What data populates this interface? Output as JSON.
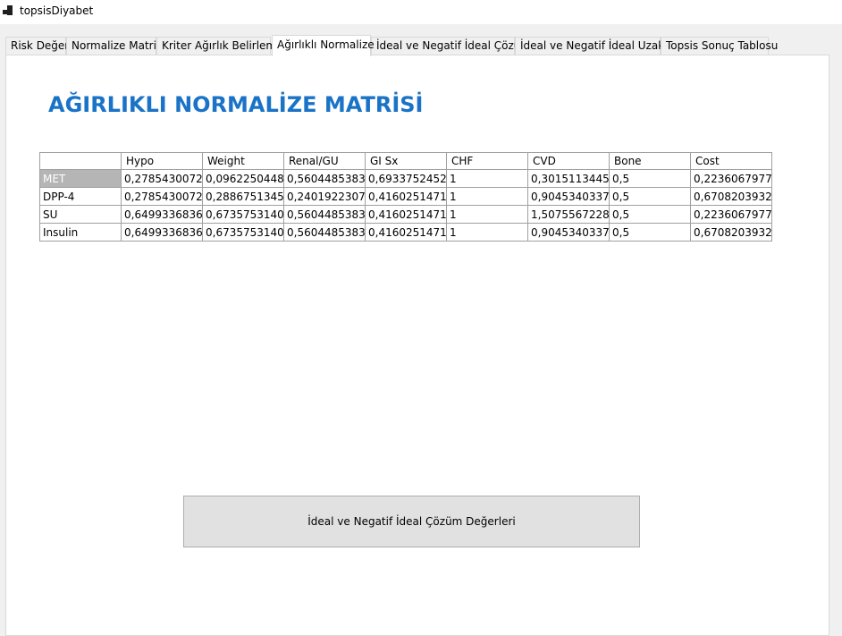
{
  "window": {
    "title": "topsisDiyabet"
  },
  "tabs": [
    {
      "label": "Risk Değer"
    },
    {
      "label": "Normalize Matris"
    },
    {
      "label": "Kriter Ağırlık Belirleme"
    },
    {
      "label": "Ağırlıklı Normalize"
    },
    {
      "label": "İdeal ve Negatif İdeal Çözüm"
    },
    {
      "label": "İdeal ve Negatif İdeal Uzaklık"
    },
    {
      "label": "Topsis Sonuç Tablosu"
    }
  ],
  "active_tab": "Ağırlıklı Normalize",
  "page": {
    "heading": "AĞIRLIKLI NORMALİZE MATRİSİ"
  },
  "grid": {
    "columns": [
      "Hypo",
      "Weight",
      "Renal/GU",
      "GI Sx",
      "CHF",
      "CVD",
      "Bone",
      "Cost"
    ],
    "rows": [
      {
        "name": "MET",
        "cells": [
          "0,2785430072...",
          "0,0962250448...",
          "0,5604485383...",
          "0,6933752452...",
          "1",
          "0,3015113445...",
          "0,5",
          "0,2236067977..."
        ]
      },
      {
        "name": "DPP-4",
        "cells": [
          "0,2785430072...",
          "0,2886751345...",
          "0,2401922307...",
          "0,4160251471...",
          "1",
          "0,9045340337...",
          "0,5",
          "0,6708203932..."
        ]
      },
      {
        "name": "SU",
        "cells": [
          "0,6499336836...",
          "0,6735753140...",
          "0,5604485383...",
          "0,4160251471...",
          "1",
          "1,5075567228...",
          "0,5",
          "0,2236067977..."
        ]
      },
      {
        "name": "Insulin",
        "cells": [
          "0,6499336836...",
          "0,6735753140...",
          "0,5604485383...",
          "0,4160251471...",
          "1",
          "0,9045340337...",
          "0,5",
          "0,6708203932..."
        ]
      }
    ]
  },
  "buttons": {
    "ideal_solution": "İdeal ve Negatif İdeal Çözüm Değerleri"
  }
}
